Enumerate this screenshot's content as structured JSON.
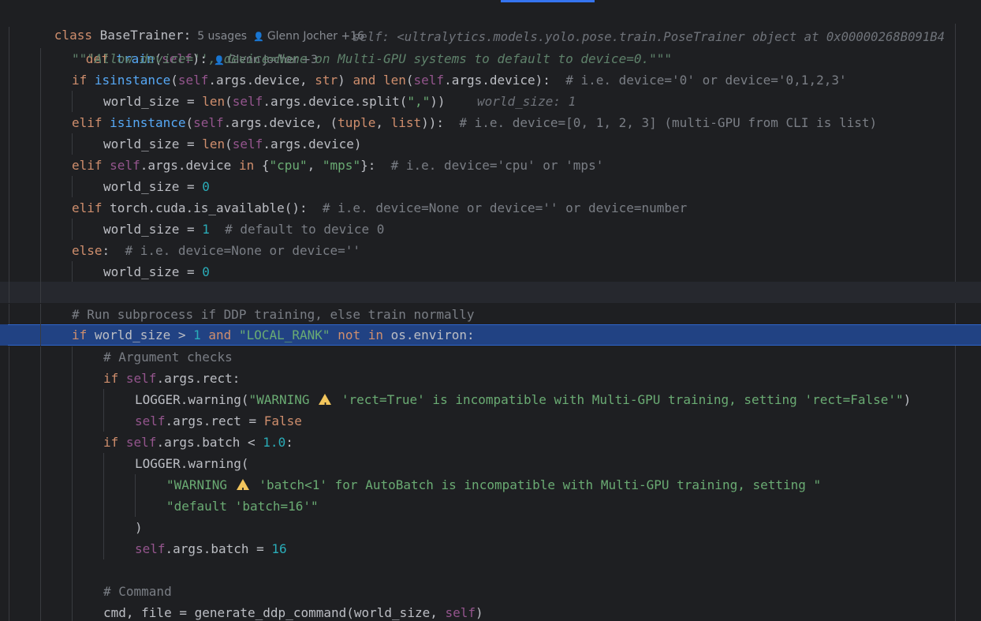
{
  "header": {
    "kw_class": "class",
    "class_name": "BaseTrainer:",
    "usages": "5 usages",
    "author": "Glenn Jocher +16"
  },
  "method": {
    "kw_def": "def",
    "name": "train",
    "params_open": "(",
    "param_self": "self",
    "params_close": "):",
    "author": "Glenn Jocher +3",
    "debug_self": "self: <ultralytics.models.yolo.pose.train.PoseTrainer object at 0x00000268B091B4"
  },
  "lines": {
    "l2": {
      "doc": "\"\"\"Allow device='', device=None on Multi-GPU systems to default to device=0.\"\"\""
    },
    "l3": {
      "kw_if": "if",
      "t1": " ",
      "fn_isinstance": "isinstance",
      "t2": "(",
      "self": "self",
      "t3": ".args.device, ",
      "bi_str": "str",
      "t4": ") ",
      "kw_and": "and",
      "t5": " ",
      "fn_len": "len",
      "t6": "(",
      "self2": "self",
      "t7": ".args.device):  ",
      "comment": "# i.e. device='0' or device='0,1,2,3'"
    },
    "l4": {
      "t1": "world_size = ",
      "fn_len": "len",
      "t2": "(",
      "self": "self",
      "t3": ".args.device.split(",
      "str": "\",\"",
      "t4": "))",
      "debug": "world_size: 1"
    },
    "l5": {
      "kw_elif": "elif",
      "t1": " ",
      "fn_isinstance": "isinstance",
      "t2": "(",
      "self": "self",
      "t3": ".args.device, (",
      "bi_tuple": "tuple",
      "t4": ", ",
      "bi_list": "list",
      "t5": ")):  ",
      "comment": "# i.e. device=[0, 1, 2, 3] (multi-GPU from CLI is list)"
    },
    "l6": {
      "t1": "world_size = ",
      "fn_len": "len",
      "t2": "(",
      "self": "self",
      "t3": ".args.device)"
    },
    "l7": {
      "kw_elif": "elif",
      "t1": " ",
      "self": "self",
      "t2": ".args.device ",
      "kw_in": "in",
      "t3": " {",
      "str1": "\"cpu\"",
      "t4": ", ",
      "str2": "\"mps\"",
      "t5": "}:  ",
      "comment": "# i.e. device='cpu' or 'mps'"
    },
    "l8": {
      "t1": "world_size = ",
      "num": "0"
    },
    "l9": {
      "kw_elif": "elif",
      "t1": " torch.cuda.is_available():  ",
      "comment": "# i.e. device=None or device='' or device=number"
    },
    "l10": {
      "t1": "world_size = ",
      "num": "1",
      "t2": "  ",
      "comment": "# default to device 0"
    },
    "l11": {
      "kw_else": "else",
      "t1": ":  ",
      "comment": "# i.e. device=None or device=''"
    },
    "l12": {
      "t1": "world_size = ",
      "num": "0"
    },
    "l14": {
      "comment": "# Run subprocess if DDP training, else train normally"
    },
    "l15": {
      "kw_if": "if",
      "t1": " world_size > ",
      "num": "1",
      "t2": " ",
      "kw_and": "and",
      "t3": " ",
      "str": "\"LOCAL_RANK\"",
      "t4": " ",
      "kw_not": "not",
      "t5": " ",
      "kw_in": "in",
      "t6": " os.environ:"
    },
    "l16": {
      "comment": "# Argument checks"
    },
    "l17": {
      "kw_if": "if",
      "t1": " ",
      "self": "self",
      "t2": ".args.rect:"
    },
    "l18": {
      "t1": "LOGGER.warning(",
      "str_a": "\"WARNING ",
      "str_b": " 'rect=True' is incompatible with Multi-GPU training, setting 'rect=False'\"",
      "t2": ")"
    },
    "l19": {
      "self": "self",
      "t1": ".args.rect = ",
      "kw_false": "False"
    },
    "l20": {
      "kw_if": "if",
      "t1": " ",
      "self": "self",
      "t2": ".args.batch < ",
      "num": "1.0",
      "t3": ":"
    },
    "l21": {
      "t1": "LOGGER.warning("
    },
    "l22": {
      "str_a": "\"WARNING ",
      "str_b": " 'batch<1' for AutoBatch is incompatible with Multi-GPU training, setting \""
    },
    "l23": {
      "str": "\"default 'batch=16'\""
    },
    "l24": {
      "t1": ")"
    },
    "l25": {
      "self": "self",
      "t1": ".args.batch = ",
      "num": "16"
    },
    "l27": {
      "comment": "# Command"
    },
    "l28": {
      "t1": "cmd, file = generate_ddp_command(world_size, ",
      "self": "self",
      "t2": ")"
    }
  },
  "icons": {
    "person": "person-icon",
    "warning": "warning-icon"
  },
  "colors": {
    "background": "#1e1f22",
    "keyword": "#cf8e6d",
    "function": "#56a8f5",
    "self": "#94558d",
    "string": "#6aab73",
    "number": "#2aacb8",
    "comment": "#7a7e85",
    "selection": "#214283",
    "accent": "#3574f0"
  }
}
